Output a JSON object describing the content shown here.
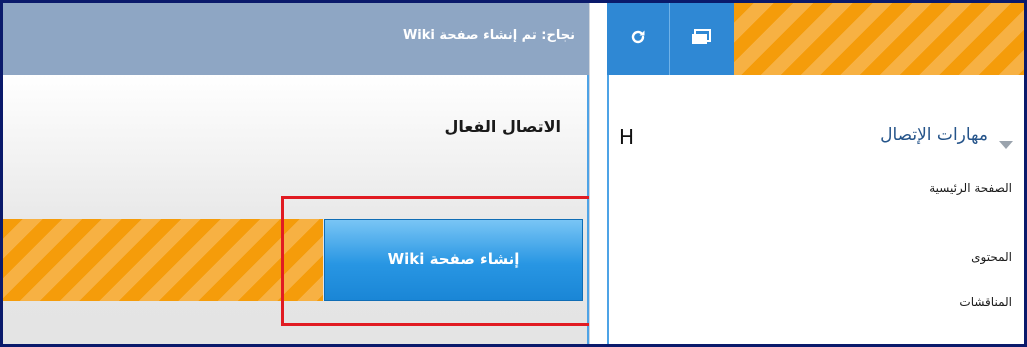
{
  "notification": {
    "success_message": "نجاح: تم إنشاء صفحة Wiki"
  },
  "main": {
    "page_title": "الاتصال الفعال",
    "create_wiki_button": "إنشاء صفحة Wiki"
  },
  "sidebar": {
    "course_title": "مهارات الإتصال",
    "h_label": "H",
    "nav_items": [
      {
        "label": "الصفحة الرئيسية"
      },
      {
        "label": "المحتوى"
      },
      {
        "label": "المناقشات"
      }
    ]
  },
  "toolbar": {
    "refresh_icon": "refresh-icon",
    "window_icon": "window-icon"
  },
  "colors": {
    "accent_blue": "#2f88d4",
    "stripe_orange": "#f59c0a",
    "success_bar": "#8ea6c4",
    "highlight_red": "#e11b22",
    "course_title": "#25548a"
  }
}
